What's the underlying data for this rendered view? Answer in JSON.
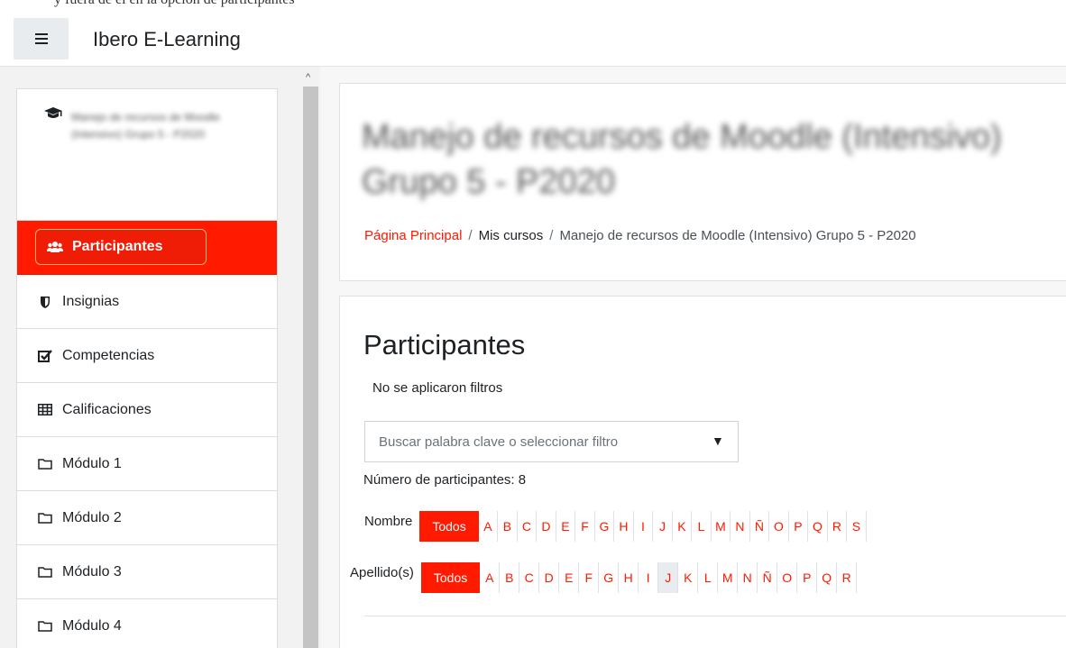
{
  "top_caption": "y fuera de él en la opción de participantes",
  "navbar": {
    "brand": "Ibero E-Learning",
    "menu_icon": "hamburger-icon"
  },
  "drawer": {
    "course_name_blurred": "Manejo de recursos de Moodle (Intensivo) Grupo 5 - P2020",
    "items": [
      {
        "label": "Participantes",
        "icon": "users-icon",
        "active": true
      },
      {
        "label": "Insignias",
        "icon": "shield-icon"
      },
      {
        "label": "Competencias",
        "icon": "checkbox-icon"
      },
      {
        "label": "Calificaciones",
        "icon": "table-icon"
      },
      {
        "label": "Módulo 1",
        "icon": "folder-icon"
      },
      {
        "label": "Módulo 2",
        "icon": "folder-icon"
      },
      {
        "label": "Módulo 3",
        "icon": "folder-icon"
      },
      {
        "label": "Módulo 4",
        "icon": "folder-icon"
      }
    ]
  },
  "header": {
    "course_title_blurred": "Manejo de recursos de Moodle (Intensivo) Grupo 5 - P2020",
    "breadcrumb": {
      "home": "Página Principal",
      "separator": "/",
      "my_courses": "Mis cursos",
      "course": "Manejo de recursos de Moodle (Intensivo) Grupo 5 - P2020"
    }
  },
  "participants": {
    "title": "Participantes",
    "no_filters": "No se aplicaron filtros",
    "search_placeholder": "Buscar palabra clave o seleccionar filtro",
    "count_text": "Número de participantes: 8",
    "first_name_label": "Nombre",
    "last_name_label": "Apellido(s)",
    "all_label": "Todos",
    "first_name_letters": [
      "A",
      "B",
      "C",
      "D",
      "E",
      "F",
      "G",
      "H",
      "I",
      "J",
      "K",
      "L",
      "M",
      "N",
      "Ñ",
      "O",
      "P",
      "Q",
      "R",
      "S"
    ],
    "last_name_letters": [
      "A",
      "B",
      "C",
      "D",
      "E",
      "F",
      "G",
      "H",
      "I",
      "J",
      "K",
      "L",
      "M",
      "N",
      "Ñ",
      "O",
      "P",
      "Q",
      "R"
    ],
    "last_name_selected": "J"
  },
  "colors": {
    "accent": "#ff1a00",
    "drawer_bg": "#f2f2f2",
    "text": "#1d2125"
  }
}
